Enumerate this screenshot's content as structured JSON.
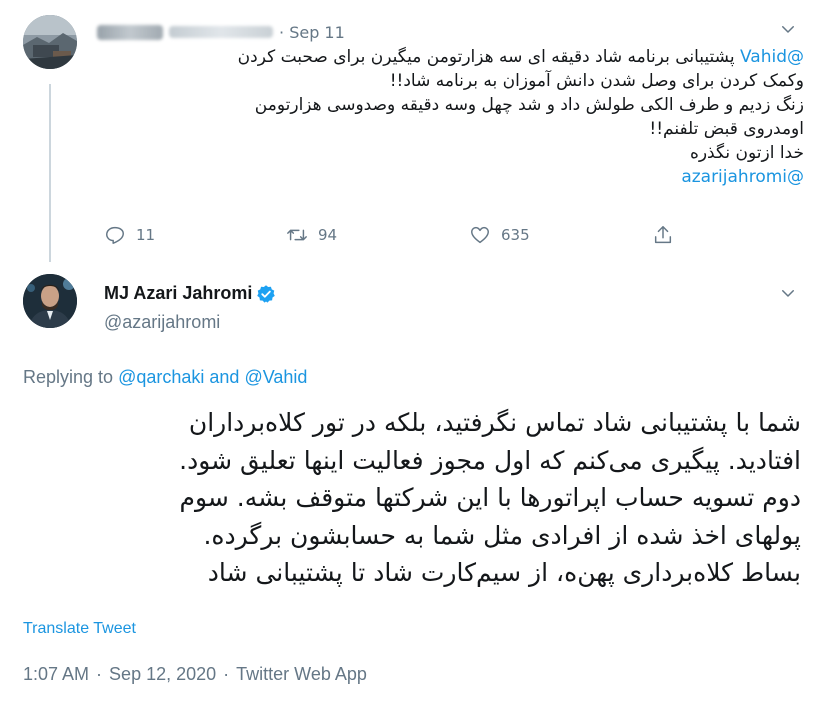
{
  "parent_tweet": {
    "date": "Sep 11",
    "body": {
      "line1_mention": "@Vahid",
      "line1_text": "پشتیبانی برنامه شاد دقیقه ای سه هزارتومن میگیرن برای صحبت کردن",
      "line2": "وکمک کردن برای وصل شدن دانش آموزان به برنامه شاد!!",
      "line3": "زنگ زدیم و طرف الکی طولش داد و شد چهل وسه دقیقه وصدوسی هزارتومن",
      "line4": "اومدروی قبض تلفنم!!",
      "line5": "خدا ازتون نگذره",
      "line6": "@azarijahromi"
    },
    "actions": {
      "reply_count": "11",
      "retweet_count": "94",
      "like_count": "635"
    }
  },
  "main_tweet": {
    "name": "MJ Azari Jahromi",
    "handle": "@azarijahromi",
    "replying_prefix": "Replying to",
    "replying_user1": "@qarchaki",
    "replying_and": "and",
    "replying_user2": "@Vahid",
    "body": {
      "line1": "شما با پشتیبانی شاد تماس نگرفتید، بلکه در تور کلاه‌برداران",
      "line2": "افتادید. پیگیری می‌کنم که اول  مجوز فعالیت اینها تعلیق شود.",
      "line3": "دوم تسویه حساب اپراتورها با این شرکتها متوقف بشه. سوم",
      "line4": "پولهای اخذ شده از افرادی مثل شما به حسابشون برگرده.",
      "line5": "بساط کلاه‌برداری پهن‌ه، از سیم‌کارت شاد تا پشتیبانی شاد"
    },
    "translate_label": "Translate Tweet",
    "time": "1:07 AM",
    "date": "Sep 12, 2020",
    "source": "Twitter Web App",
    "separator": "·"
  },
  "icons": [
    "reply-icon",
    "retweet-icon",
    "like-icon",
    "share-icon",
    "chevron-down-icon",
    "verified-badge-icon"
  ],
  "colors": {
    "link": "#1b95e0",
    "secondary_text": "#657786",
    "primary_text": "#14171a",
    "thread_line": "#ccd6dd"
  }
}
